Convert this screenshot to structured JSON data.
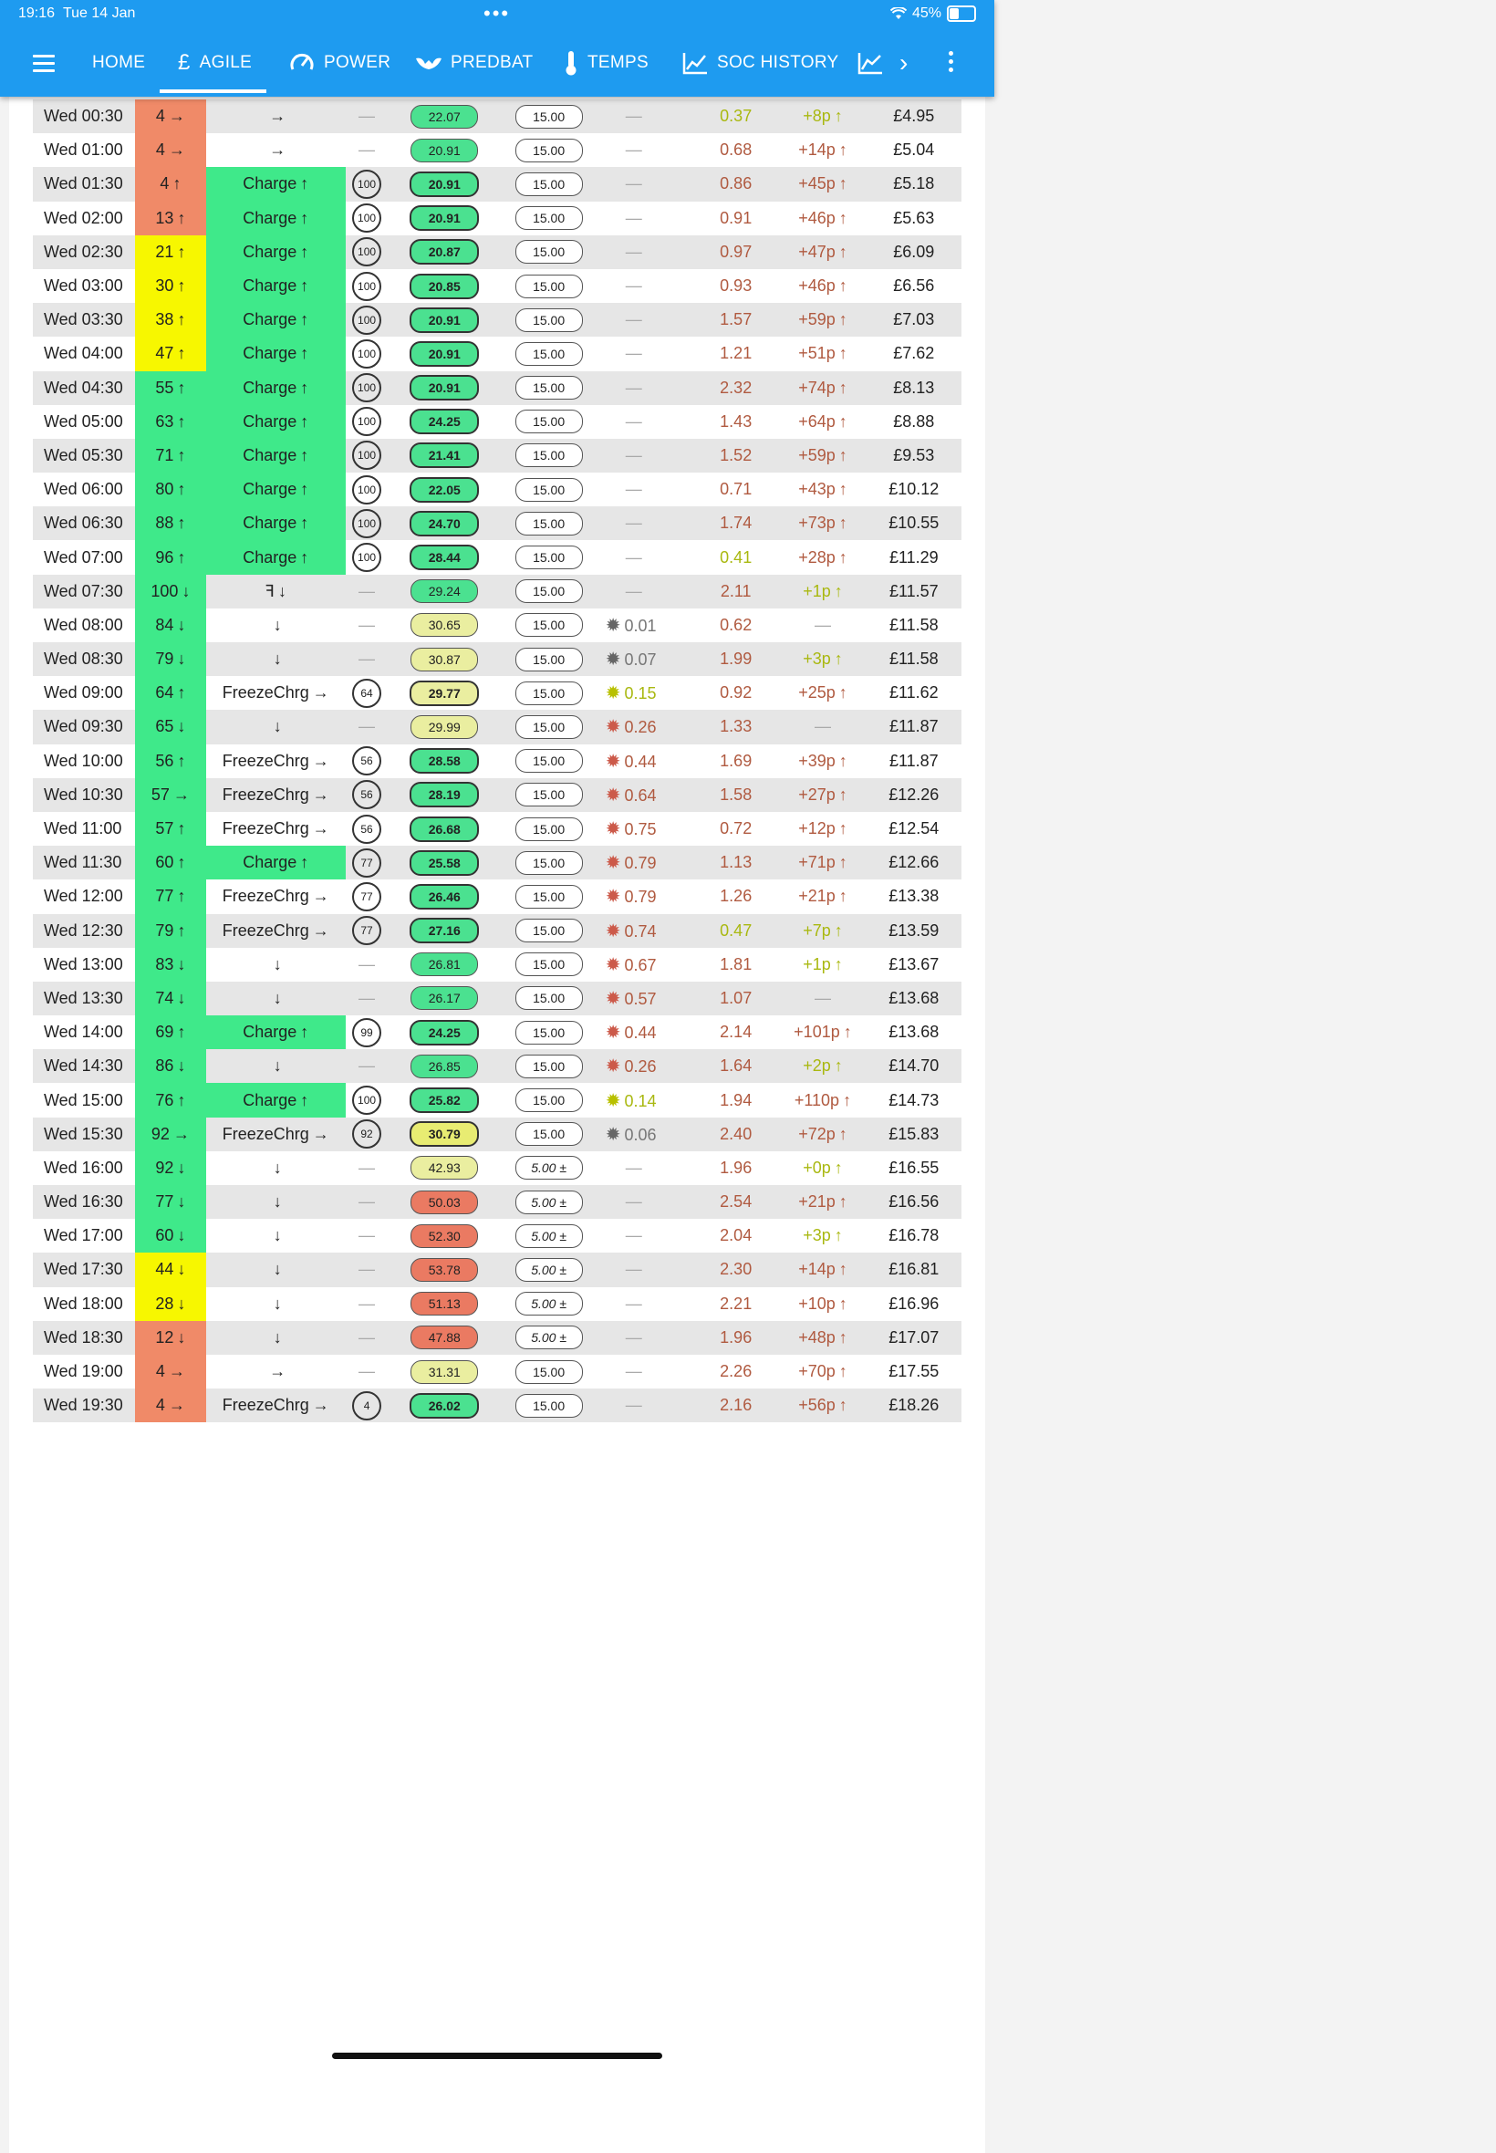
{
  "status_bar": {
    "time": "19:16",
    "date": "Tue 14 Jan",
    "wifi_icon": "wifi-icon",
    "battery": "45%"
  },
  "nav": {
    "items": [
      {
        "label": "HOME",
        "icon": ""
      },
      {
        "label": "AGILE",
        "icon": "£"
      },
      {
        "label": "POWER",
        "icon": "gauge-icon"
      },
      {
        "label": "PREDBAT",
        "icon": "bat-icon"
      },
      {
        "label": "TEMPS",
        "icon": "thermometer-icon"
      },
      {
        "label": "SOC HISTORY",
        "icon": "chart-line-icon"
      }
    ],
    "active": "AGILE"
  },
  "colors": {
    "bar": "#1e9bf0",
    "green": "#3fe98a",
    "yellow": "#f7f700",
    "red": "#f08a68"
  },
  "rows": [
    {
      "time": "Wed 00:30",
      "soc": "4",
      "soc_arrow": "→",
      "soc_bg": "red",
      "state": "",
      "state_arrow": "→",
      "state_bg": "",
      "limit": "",
      "rate": "22.07",
      "rate_cls": "g",
      "export": "15.00",
      "export_cls": "w",
      "pv": "",
      "pv_sun": "",
      "load": "0.37",
      "load_cls": "olive",
      "cost": "+8p",
      "cost_arrow": "↑",
      "cost_cls": "olive",
      "total": "£4.95"
    },
    {
      "time": "Wed 01:00",
      "soc": "4",
      "soc_arrow": "→",
      "soc_bg": "red",
      "state": "",
      "state_arrow": "→",
      "state_bg": "",
      "limit": "",
      "rate": "20.91",
      "rate_cls": "g",
      "export": "15.00",
      "export_cls": "w",
      "pv": "",
      "pv_sun": "",
      "load": "0.68",
      "load_cls": "brown",
      "cost": "+14p",
      "cost_arrow": "↑",
      "cost_cls": "brown",
      "total": "£5.04"
    },
    {
      "time": "Wed 01:30",
      "soc": "4",
      "soc_arrow": "↑",
      "soc_bg": "red",
      "state": "Charge",
      "state_arrow": "↑",
      "state_bg": "green",
      "limit": "100",
      "rate": "20.91",
      "rate_cls": "g b",
      "export": "15.00",
      "export_cls": "w",
      "pv": "",
      "pv_sun": "",
      "load": "0.86",
      "load_cls": "brown",
      "cost": "+45p",
      "cost_arrow": "↑",
      "cost_cls": "brown",
      "total": "£5.18"
    },
    {
      "time": "Wed 02:00",
      "soc": "13",
      "soc_arrow": "↑",
      "soc_bg": "red",
      "state": "Charge",
      "state_arrow": "↑",
      "state_bg": "green",
      "limit": "100",
      "rate": "20.91",
      "rate_cls": "g b",
      "export": "15.00",
      "export_cls": "w",
      "pv": "",
      "pv_sun": "",
      "load": "0.91",
      "load_cls": "brown",
      "cost": "+46p",
      "cost_arrow": "↑",
      "cost_cls": "brown",
      "total": "£5.63"
    },
    {
      "time": "Wed 02:30",
      "soc": "21",
      "soc_arrow": "↑",
      "soc_bg": "yellow",
      "state": "Charge",
      "state_arrow": "↑",
      "state_bg": "green",
      "limit": "100",
      "rate": "20.87",
      "rate_cls": "g b",
      "export": "15.00",
      "export_cls": "w",
      "pv": "",
      "pv_sun": "",
      "load": "0.97",
      "load_cls": "brown",
      "cost": "+47p",
      "cost_arrow": "↑",
      "cost_cls": "brown",
      "total": "£6.09"
    },
    {
      "time": "Wed 03:00",
      "soc": "30",
      "soc_arrow": "↑",
      "soc_bg": "yellow",
      "state": "Charge",
      "state_arrow": "↑",
      "state_bg": "green",
      "limit": "100",
      "rate": "20.85",
      "rate_cls": "g b",
      "export": "15.00",
      "export_cls": "w",
      "pv": "",
      "pv_sun": "",
      "load": "0.93",
      "load_cls": "brown",
      "cost": "+46p",
      "cost_arrow": "↑",
      "cost_cls": "brown",
      "total": "£6.56"
    },
    {
      "time": "Wed 03:30",
      "soc": "38",
      "soc_arrow": "↑",
      "soc_bg": "yellow",
      "state": "Charge",
      "state_arrow": "↑",
      "state_bg": "green",
      "limit": "100",
      "rate": "20.91",
      "rate_cls": "g b",
      "export": "15.00",
      "export_cls": "w",
      "pv": "",
      "pv_sun": "",
      "load": "1.57",
      "load_cls": "brown",
      "cost": "+59p",
      "cost_arrow": "↑",
      "cost_cls": "brown",
      "total": "£7.03"
    },
    {
      "time": "Wed 04:00",
      "soc": "47",
      "soc_arrow": "↑",
      "soc_bg": "yellow",
      "state": "Charge",
      "state_arrow": "↑",
      "state_bg": "green",
      "limit": "100",
      "rate": "20.91",
      "rate_cls": "g b",
      "export": "15.00",
      "export_cls": "w",
      "pv": "",
      "pv_sun": "",
      "load": "1.21",
      "load_cls": "brown",
      "cost": "+51p",
      "cost_arrow": "↑",
      "cost_cls": "brown",
      "total": "£7.62"
    },
    {
      "time": "Wed 04:30",
      "soc": "55",
      "soc_arrow": "↑",
      "soc_bg": "green",
      "state": "Charge",
      "state_arrow": "↑",
      "state_bg": "green",
      "limit": "100",
      "rate": "20.91",
      "rate_cls": "g b",
      "export": "15.00",
      "export_cls": "w",
      "pv": "",
      "pv_sun": "",
      "load": "2.32",
      "load_cls": "brown",
      "cost": "+74p",
      "cost_arrow": "↑",
      "cost_cls": "brown",
      "total": "£8.13"
    },
    {
      "time": "Wed 05:00",
      "soc": "63",
      "soc_arrow": "↑",
      "soc_bg": "green",
      "state": "Charge",
      "state_arrow": "↑",
      "state_bg": "green",
      "limit": "100",
      "rate": "24.25",
      "rate_cls": "g b",
      "export": "15.00",
      "export_cls": "w",
      "pv": "",
      "pv_sun": "",
      "load": "1.43",
      "load_cls": "brown",
      "cost": "+64p",
      "cost_arrow": "↑",
      "cost_cls": "brown",
      "total": "£8.88"
    },
    {
      "time": "Wed 05:30",
      "soc": "71",
      "soc_arrow": "↑",
      "soc_bg": "green",
      "state": "Charge",
      "state_arrow": "↑",
      "state_bg": "green",
      "limit": "100",
      "rate": "21.41",
      "rate_cls": "g b",
      "export": "15.00",
      "export_cls": "w",
      "pv": "",
      "pv_sun": "",
      "load": "1.52",
      "load_cls": "brown",
      "cost": "+59p",
      "cost_arrow": "↑",
      "cost_cls": "brown",
      "total": "£9.53"
    },
    {
      "time": "Wed 06:00",
      "soc": "80",
      "soc_arrow": "↑",
      "soc_bg": "green",
      "state": "Charge",
      "state_arrow": "↑",
      "state_bg": "green",
      "limit": "100",
      "rate": "22.05",
      "rate_cls": "g b",
      "export": "15.00",
      "export_cls": "w",
      "pv": "",
      "pv_sun": "",
      "load": "0.71",
      "load_cls": "brown",
      "cost": "+43p",
      "cost_arrow": "↑",
      "cost_cls": "brown",
      "total": "£10.12"
    },
    {
      "time": "Wed 06:30",
      "soc": "88",
      "soc_arrow": "↑",
      "soc_bg": "green",
      "state": "Charge",
      "state_arrow": "↑",
      "state_bg": "green",
      "limit": "100",
      "rate": "24.70",
      "rate_cls": "g b",
      "export": "15.00",
      "export_cls": "w",
      "pv": "",
      "pv_sun": "",
      "load": "1.74",
      "load_cls": "brown",
      "cost": "+73p",
      "cost_arrow": "↑",
      "cost_cls": "brown",
      "total": "£10.55"
    },
    {
      "time": "Wed 07:00",
      "soc": "96",
      "soc_arrow": "↑",
      "soc_bg": "green",
      "state": "Charge",
      "state_arrow": "↑",
      "state_bg": "green",
      "limit": "100",
      "rate": "28.44",
      "rate_cls": "g b",
      "export": "15.00",
      "export_cls": "w",
      "pv": "",
      "pv_sun": "",
      "load": "0.41",
      "load_cls": "olive",
      "cost": "+28p",
      "cost_arrow": "↑",
      "cost_cls": "brown",
      "total": "£11.29"
    },
    {
      "time": "Wed 07:30",
      "soc": "100",
      "soc_arrow": "↓",
      "soc_bg": "green",
      "state": "ꟻ",
      "state_arrow": "↓",
      "state_bg": "",
      "limit": "",
      "rate": "29.24",
      "rate_cls": "g",
      "export": "15.00",
      "export_cls": "w",
      "pv": "",
      "pv_sun": "",
      "load": "2.11",
      "load_cls": "brown",
      "cost": "+1p",
      "cost_arrow": "↑",
      "cost_cls": "olive",
      "total": "£11.57"
    },
    {
      "time": "Wed 08:00",
      "soc": "84",
      "soc_arrow": "↓",
      "soc_bg": "green",
      "state": "",
      "state_arrow": "↓",
      "state_bg": "",
      "limit": "",
      "rate": "30.65",
      "rate_cls": "ly",
      "export": "15.00",
      "export_cls": "w",
      "pv": "0.01",
      "pv_sun": "gray",
      "load": "0.62",
      "load_cls": "brown",
      "cost": "",
      "cost_arrow": "",
      "cost_cls": "gray",
      "total": "£11.58"
    },
    {
      "time": "Wed 08:30",
      "soc": "79",
      "soc_arrow": "↓",
      "soc_bg": "green",
      "state": "",
      "state_arrow": "↓",
      "state_bg": "",
      "limit": "",
      "rate": "30.87",
      "rate_cls": "ly",
      "export": "15.00",
      "export_cls": "w",
      "pv": "0.07",
      "pv_sun": "gray",
      "load": "1.99",
      "load_cls": "brown",
      "cost": "+3p",
      "cost_arrow": "↑",
      "cost_cls": "olive",
      "total": "£11.58"
    },
    {
      "time": "Wed 09:00",
      "soc": "64",
      "soc_arrow": "↑",
      "soc_bg": "green",
      "state": "FreezeChrg",
      "state_arrow": "→",
      "state_bg": "",
      "limit": "64",
      "rate": "29.77",
      "rate_cls": "ly b",
      "export": "15.00",
      "export_cls": "w",
      "pv": "0.15",
      "pv_sun": "yel",
      "load": "0.92",
      "load_cls": "brown",
      "cost": "+25p",
      "cost_arrow": "↑",
      "cost_cls": "brown",
      "total": "£11.62"
    },
    {
      "time": "Wed 09:30",
      "soc": "65",
      "soc_arrow": "↓",
      "soc_bg": "green",
      "state": "",
      "state_arrow": "↓",
      "state_bg": "",
      "limit": "",
      "rate": "29.99",
      "rate_cls": "ly",
      "export": "15.00",
      "export_cls": "w",
      "pv": "0.26",
      "pv_sun": "red",
      "load": "1.33",
      "load_cls": "brown",
      "cost": "",
      "cost_arrow": "",
      "cost_cls": "gray",
      "total": "£11.87"
    },
    {
      "time": "Wed 10:00",
      "soc": "56",
      "soc_arrow": "↑",
      "soc_bg": "green",
      "state": "FreezeChrg",
      "state_arrow": "→",
      "state_bg": "",
      "limit": "56",
      "rate": "28.58",
      "rate_cls": "g b",
      "export": "15.00",
      "export_cls": "w",
      "pv": "0.44",
      "pv_sun": "red",
      "load": "1.69",
      "load_cls": "brown",
      "cost": "+39p",
      "cost_arrow": "↑",
      "cost_cls": "brown",
      "total": "£11.87"
    },
    {
      "time": "Wed 10:30",
      "soc": "57",
      "soc_arrow": "→",
      "soc_bg": "green",
      "state": "FreezeChrg",
      "state_arrow": "→",
      "state_bg": "",
      "limit": "56",
      "rate": "28.19",
      "rate_cls": "g b",
      "export": "15.00",
      "export_cls": "w",
      "pv": "0.64",
      "pv_sun": "red",
      "load": "1.58",
      "load_cls": "brown",
      "cost": "+27p",
      "cost_arrow": "↑",
      "cost_cls": "brown",
      "total": "£12.26"
    },
    {
      "time": "Wed 11:00",
      "soc": "57",
      "soc_arrow": "↑",
      "soc_bg": "green",
      "state": "FreezeChrg",
      "state_arrow": "→",
      "state_bg": "",
      "limit": "56",
      "rate": "26.68",
      "rate_cls": "g b",
      "export": "15.00",
      "export_cls": "w",
      "pv": "0.75",
      "pv_sun": "red",
      "load": "0.72",
      "load_cls": "brown",
      "cost": "+12p",
      "cost_arrow": "↑",
      "cost_cls": "brown",
      "total": "£12.54"
    },
    {
      "time": "Wed 11:30",
      "soc": "60",
      "soc_arrow": "↑",
      "soc_bg": "green",
      "state": "Charge",
      "state_arrow": "↑",
      "state_bg": "green",
      "limit": "77",
      "rate": "25.58",
      "rate_cls": "g b",
      "export": "15.00",
      "export_cls": "w",
      "pv": "0.79",
      "pv_sun": "red",
      "load": "1.13",
      "load_cls": "brown",
      "cost": "+71p",
      "cost_arrow": "↑",
      "cost_cls": "brown",
      "total": "£12.66"
    },
    {
      "time": "Wed 12:00",
      "soc": "77",
      "soc_arrow": "↑",
      "soc_bg": "green",
      "state": "FreezeChrg",
      "state_arrow": "→",
      "state_bg": "",
      "limit": "77",
      "rate": "26.46",
      "rate_cls": "g b",
      "export": "15.00",
      "export_cls": "w",
      "pv": "0.79",
      "pv_sun": "red",
      "load": "1.26",
      "load_cls": "brown",
      "cost": "+21p",
      "cost_arrow": "↑",
      "cost_cls": "brown",
      "total": "£13.38"
    },
    {
      "time": "Wed 12:30",
      "soc": "79",
      "soc_arrow": "↑",
      "soc_bg": "green",
      "state": "FreezeChrg",
      "state_arrow": "→",
      "state_bg": "",
      "limit": "77",
      "rate": "27.16",
      "rate_cls": "g b",
      "export": "15.00",
      "export_cls": "w",
      "pv": "0.74",
      "pv_sun": "red",
      "load": "0.47",
      "load_cls": "olive",
      "cost": "+7p",
      "cost_arrow": "↑",
      "cost_cls": "olive",
      "total": "£13.59"
    },
    {
      "time": "Wed 13:00",
      "soc": "83",
      "soc_arrow": "↓",
      "soc_bg": "green",
      "state": "",
      "state_arrow": "↓",
      "state_bg": "",
      "limit": "",
      "rate": "26.81",
      "rate_cls": "g",
      "export": "15.00",
      "export_cls": "w",
      "pv": "0.67",
      "pv_sun": "red",
      "load": "1.81",
      "load_cls": "brown",
      "cost": "+1p",
      "cost_arrow": "↑",
      "cost_cls": "olive",
      "total": "£13.67"
    },
    {
      "time": "Wed 13:30",
      "soc": "74",
      "soc_arrow": "↓",
      "soc_bg": "green",
      "state": "",
      "state_arrow": "↓",
      "state_bg": "",
      "limit": "",
      "rate": "26.17",
      "rate_cls": "g",
      "export": "15.00",
      "export_cls": "w",
      "pv": "0.57",
      "pv_sun": "red",
      "load": "1.07",
      "load_cls": "brown",
      "cost": "",
      "cost_arrow": "",
      "cost_cls": "gray",
      "total": "£13.68"
    },
    {
      "time": "Wed 14:00",
      "soc": "69",
      "soc_arrow": "↑",
      "soc_bg": "green",
      "state": "Charge",
      "state_arrow": "↑",
      "state_bg": "green",
      "limit": "99",
      "rate": "24.25",
      "rate_cls": "g b",
      "export": "15.00",
      "export_cls": "w",
      "pv": "0.44",
      "pv_sun": "red",
      "load": "2.14",
      "load_cls": "brown",
      "cost": "+101p",
      "cost_arrow": "↑",
      "cost_cls": "brown",
      "total": "£13.68"
    },
    {
      "time": "Wed 14:30",
      "soc": "86",
      "soc_arrow": "↓",
      "soc_bg": "green",
      "state": "",
      "state_arrow": "↓",
      "state_bg": "",
      "limit": "",
      "rate": "26.85",
      "rate_cls": "g",
      "export": "15.00",
      "export_cls": "w",
      "pv": "0.26",
      "pv_sun": "red",
      "load": "1.64",
      "load_cls": "brown",
      "cost": "+2p",
      "cost_arrow": "↑",
      "cost_cls": "olive",
      "total": "£14.70"
    },
    {
      "time": "Wed 15:00",
      "soc": "76",
      "soc_arrow": "↑",
      "soc_bg": "green",
      "state": "Charge",
      "state_arrow": "↑",
      "state_bg": "green",
      "limit": "100",
      "rate": "25.82",
      "rate_cls": "g b",
      "export": "15.00",
      "export_cls": "w",
      "pv": "0.14",
      "pv_sun": "yel",
      "load": "1.94",
      "load_cls": "brown",
      "cost": "+110p",
      "cost_arrow": "↑",
      "cost_cls": "brown",
      "total": "£14.73"
    },
    {
      "time": "Wed 15:30",
      "soc": "92",
      "soc_arrow": "→",
      "soc_bg": "green",
      "state": "FreezeChrg",
      "state_arrow": "→",
      "state_bg": "",
      "limit": "92",
      "rate": "30.79",
      "rate_cls": "y b",
      "export": "15.00",
      "export_cls": "w",
      "pv": "0.06",
      "pv_sun": "gray",
      "load": "2.40",
      "load_cls": "brown",
      "cost": "+72p",
      "cost_arrow": "↑",
      "cost_cls": "brown",
      "total": "£15.83"
    },
    {
      "time": "Wed 16:00",
      "soc": "92",
      "soc_arrow": "↓",
      "soc_bg": "green",
      "state": "",
      "state_arrow": "↓",
      "state_bg": "",
      "limit": "",
      "rate": "42.93",
      "rate_cls": "ly",
      "export": "5.00 ±",
      "export_cls": "w it",
      "pv": "",
      "pv_sun": "",
      "load": "1.96",
      "load_cls": "brown",
      "cost": "+0p",
      "cost_arrow": "↑",
      "cost_cls": "olive",
      "total": "£16.55"
    },
    {
      "time": "Wed 16:30",
      "soc": "77",
      "soc_arrow": "↓",
      "soc_bg": "green",
      "state": "",
      "state_arrow": "↓",
      "state_bg": "",
      "limit": "",
      "rate": "50.03",
      "rate_cls": "r",
      "export": "5.00 ±",
      "export_cls": "w it",
      "pv": "",
      "pv_sun": "",
      "load": "2.54",
      "load_cls": "brown",
      "cost": "+21p",
      "cost_arrow": "↑",
      "cost_cls": "brown",
      "total": "£16.56"
    },
    {
      "time": "Wed 17:00",
      "soc": "60",
      "soc_arrow": "↓",
      "soc_bg": "green",
      "state": "",
      "state_arrow": "↓",
      "state_bg": "",
      "limit": "",
      "rate": "52.30",
      "rate_cls": "r",
      "export": "5.00 ±",
      "export_cls": "w it",
      "pv": "",
      "pv_sun": "",
      "load": "2.04",
      "load_cls": "brown",
      "cost": "+3p",
      "cost_arrow": "↑",
      "cost_cls": "olive",
      "total": "£16.78"
    },
    {
      "time": "Wed 17:30",
      "soc": "44",
      "soc_arrow": "↓",
      "soc_bg": "yellow",
      "state": "",
      "state_arrow": "↓",
      "state_bg": "",
      "limit": "",
      "rate": "53.78",
      "rate_cls": "r",
      "export": "5.00 ±",
      "export_cls": "w it",
      "pv": "",
      "pv_sun": "",
      "load": "2.30",
      "load_cls": "brown",
      "cost": "+14p",
      "cost_arrow": "↑",
      "cost_cls": "brown",
      "total": "£16.81"
    },
    {
      "time": "Wed 18:00",
      "soc": "28",
      "soc_arrow": "↓",
      "soc_bg": "yellow",
      "state": "",
      "state_arrow": "↓",
      "state_bg": "",
      "limit": "",
      "rate": "51.13",
      "rate_cls": "r",
      "export": "5.00 ±",
      "export_cls": "w it",
      "pv": "",
      "pv_sun": "",
      "load": "2.21",
      "load_cls": "brown",
      "cost": "+10p",
      "cost_arrow": "↑",
      "cost_cls": "brown",
      "total": "£16.96"
    },
    {
      "time": "Wed 18:30",
      "soc": "12",
      "soc_arrow": "↓",
      "soc_bg": "red",
      "state": "",
      "state_arrow": "↓",
      "state_bg": "",
      "limit": "",
      "rate": "47.88",
      "rate_cls": "r",
      "export": "5.00 ±",
      "export_cls": "w it",
      "pv": "",
      "pv_sun": "",
      "load": "1.96",
      "load_cls": "brown",
      "cost": "+48p",
      "cost_arrow": "↑",
      "cost_cls": "brown",
      "total": "£17.07"
    },
    {
      "time": "Wed 19:00",
      "soc": "4",
      "soc_arrow": "→",
      "soc_bg": "red",
      "state": "",
      "state_arrow": "→",
      "state_bg": "",
      "limit": "",
      "rate": "31.31",
      "rate_cls": "ly",
      "export": "15.00",
      "export_cls": "w",
      "pv": "",
      "pv_sun": "",
      "load": "2.26",
      "load_cls": "brown",
      "cost": "+70p",
      "cost_arrow": "↑",
      "cost_cls": "brown",
      "total": "£17.55"
    },
    {
      "time": "Wed 19:30",
      "soc": "4",
      "soc_arrow": "→",
      "soc_bg": "red",
      "state": "FreezeChrg",
      "state_arrow": "→",
      "state_bg": "",
      "limit": "4",
      "rate": "26.02",
      "rate_cls": "g b",
      "export": "15.00",
      "export_cls": "w",
      "pv": "",
      "pv_sun": "",
      "load": "2.16",
      "load_cls": "brown",
      "cost": "+56p",
      "cost_arrow": "↑",
      "cost_cls": "brown",
      "total": "£18.26"
    }
  ]
}
